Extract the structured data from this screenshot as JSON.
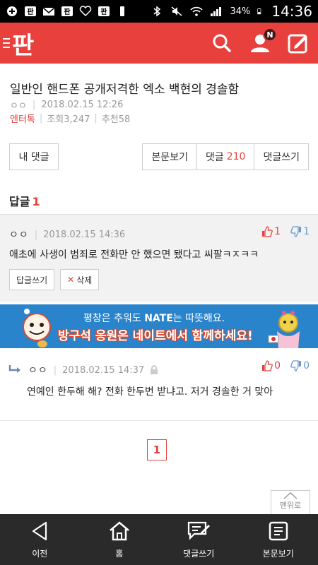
{
  "status": {
    "battery": "34%",
    "time": "14:36"
  },
  "header": {
    "logo": "판",
    "badge": "N"
  },
  "article": {
    "title": "일반인 핸드폰 공개저격한 엑소 백현의 경솔함",
    "author": "ㅇㅇ",
    "date": "2018.02.15 12:26",
    "category": "엔터톡",
    "views": "조회3,247",
    "recommend": "추천58"
  },
  "tabs": {
    "my_comments": "내 댓글",
    "view_post": "본문보기",
    "comments_label": "댓글",
    "comments_count": "210",
    "write_comment": "댓글쓰기"
  },
  "replies": {
    "label": "답글",
    "count": "1"
  },
  "comment1": {
    "user": "ㅇㅇ",
    "date": "2018.02.15 14:36",
    "text": "애초에 사생이 범죄로 전화만 안 했으면 됐다고 씨팔ㅋㅈㅋㅋ",
    "up": "1",
    "down": "1",
    "reply_btn": "답글쓰기",
    "delete_btn": "삭제"
  },
  "banner": {
    "line1_a": "평창은 추워도 ",
    "line1_brand": "NATE",
    "line1_b": "는 따뜻해요.",
    "line2": "방구석 응원은 네이트에서 함께하세요!"
  },
  "comment2": {
    "user": "ㅇㅇ",
    "date": "2018.02.15 14:37",
    "text": "연예인 한두해 해? 전화 한두번 받냐고. 저거 경솔한 거 맞아",
    "up": "0",
    "down": "0"
  },
  "pager": {
    "current": "1"
  },
  "top_button": "맨위로",
  "bottom_nav": {
    "back": "이전",
    "home": "홈",
    "write": "댓글쓰기",
    "view": "본문보기"
  },
  "colors": {
    "brand": "#e8403c",
    "banner": "#2a84cc",
    "nav_bg": "#2a2a2a"
  }
}
